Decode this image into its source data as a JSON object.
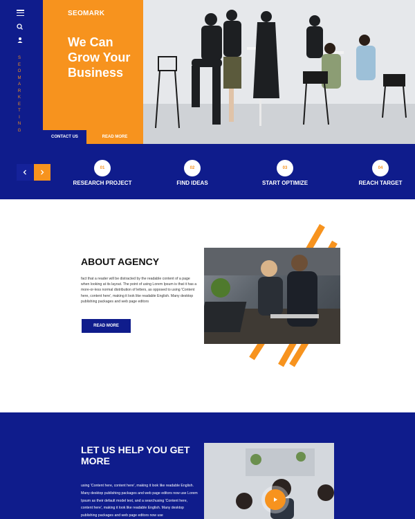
{
  "sidebar": {
    "menu_icon": "hamburger-menu-icon",
    "search_icon": "search-icon",
    "user_icon": "user-icon",
    "vertical_text": "SEOMARKETING"
  },
  "hero": {
    "brand": "SEOMARK",
    "headline": "We Can Grow Your Business",
    "contact_label": "CONTACT US",
    "read_more_label": "READ MORE"
  },
  "steps": {
    "prev_icon": "chevron-left-icon",
    "next_icon": "chevron-right-icon",
    "items": [
      {
        "num": "01",
        "title": "RESEARCH PROJECT"
      },
      {
        "num": "02",
        "title": "FIND IDEAS"
      },
      {
        "num": "03",
        "title": "START OPTIMIZE"
      },
      {
        "num": "04",
        "title": "REACH TARGET"
      }
    ]
  },
  "about": {
    "title": "ABOUT AGENCY",
    "body": "fact that a reader will be distracted by the readable content of a page when looking at its layout. The point of using Lorem Ipsum is that it has a more-or-less normal distribution of letters, as opposed to using 'Content here, content here', making it look like readable English. Many desktop publishing packages and web page editors",
    "button_label": "READ MORE"
  },
  "help": {
    "title": "LET US HELP YOU GET MORE",
    "body": "using 'Content here, content here', making it look like readable English. Many desktop publishing packages and web page editors now use Lorem Ipsum as their default model text, and a searchusing 'Content here, content here', making it look like readable English. Many desktop publishing packages and web page editors now use",
    "play_icon": "play-icon"
  },
  "colors": {
    "navy": "#0f1c8c",
    "orange": "#f7931e",
    "white": "#ffffff"
  }
}
